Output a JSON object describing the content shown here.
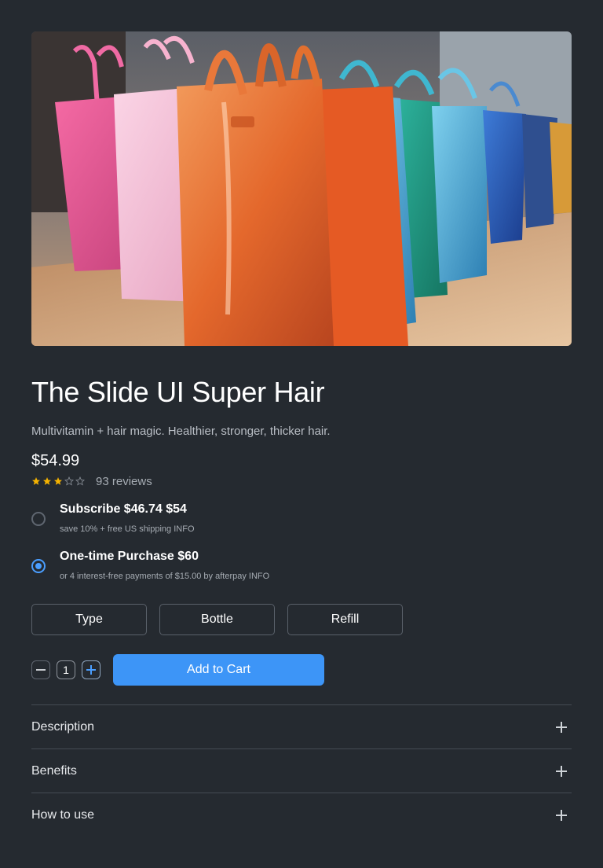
{
  "product": {
    "image_alt": "Colorful glossy shopping bags",
    "title": "The Slide UI Super Hair",
    "subtitle": "Multivitamin + hair magic. Healthier, stronger, thicker hair.",
    "price": "$54.99",
    "rating": 3,
    "rating_max": 5,
    "reviews": "93 reviews"
  },
  "purchase_options": [
    {
      "label": "Subscribe $46.74 $54",
      "note": "save 10% + free US shipping INFO",
      "selected": false
    },
    {
      "label": "One-time Purchase $60",
      "note": "or 4 interest-free payments of $15.00 by afterpay INFO",
      "selected": true
    }
  ],
  "variants": [
    "Type",
    "Bottle",
    "Refill"
  ],
  "quantity": "1",
  "add_to_cart_label": "Add to Cart",
  "accordion": [
    "Description",
    "Benefits",
    "How to use"
  ],
  "colors": {
    "background": "#252a30",
    "accent": "#3d95f7",
    "star": "#f5b301"
  },
  "icons": {
    "minus": "minus-icon",
    "plus": "plus-icon",
    "star": "star-icon",
    "radio": "radio-icon"
  }
}
